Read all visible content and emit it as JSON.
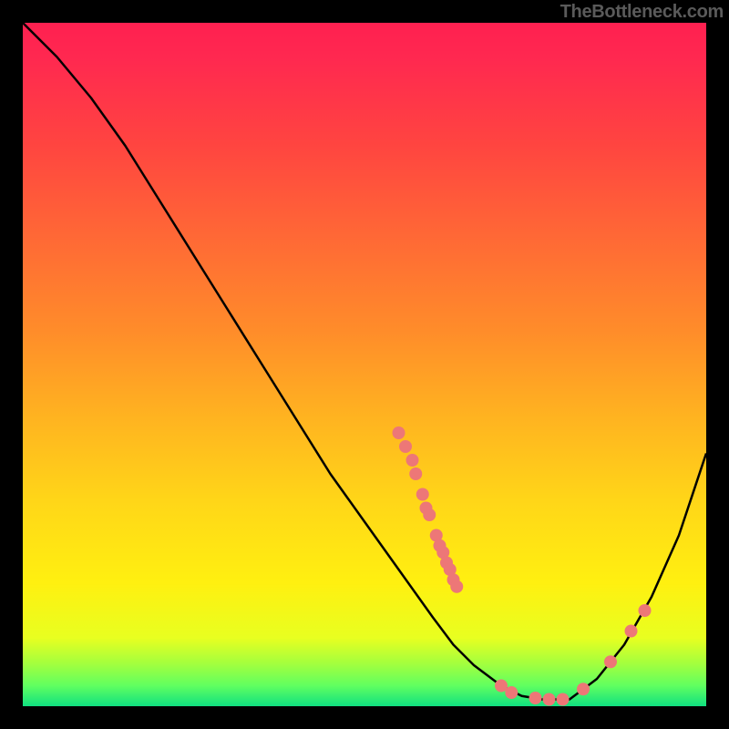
{
  "attribution": "TheBottleneck.com",
  "chart_data": {
    "type": "line",
    "title": "",
    "xlabel": "",
    "ylabel": "",
    "xlim": [
      0,
      100
    ],
    "ylim": [
      0,
      100
    ],
    "series": [
      {
        "name": "bottleneck-curve",
        "x": [
          0,
          5,
          10,
          15,
          20,
          25,
          30,
          35,
          40,
          45,
          50,
          55,
          60,
          63,
          66,
          70,
          73,
          76,
          80,
          84,
          88,
          92,
          96,
          100
        ],
        "y": [
          100,
          95,
          89,
          82,
          74,
          66,
          58,
          50,
          42,
          34,
          27,
          20,
          13,
          9,
          6,
          3,
          1.5,
          1,
          1,
          4,
          9,
          16,
          25,
          37
        ],
        "color": "#000000",
        "stroke_width": 2.5
      }
    ],
    "markers": {
      "name": "scatter-dots",
      "color": "#ed7777",
      "radius": 7,
      "points": [
        {
          "x": 55,
          "y": 40
        },
        {
          "x": 56,
          "y": 38
        },
        {
          "x": 57,
          "y": 36
        },
        {
          "x": 57.5,
          "y": 34
        },
        {
          "x": 58.5,
          "y": 31
        },
        {
          "x": 59,
          "y": 29
        },
        {
          "x": 59.5,
          "y": 28
        },
        {
          "x": 60.5,
          "y": 25
        },
        {
          "x": 61,
          "y": 23.5
        },
        {
          "x": 61.5,
          "y": 22.5
        },
        {
          "x": 62,
          "y": 21
        },
        {
          "x": 62.5,
          "y": 20
        },
        {
          "x": 63,
          "y": 18.5
        },
        {
          "x": 63.5,
          "y": 17.5
        },
        {
          "x": 70,
          "y": 3
        },
        {
          "x": 71.5,
          "y": 2
        },
        {
          "x": 75,
          "y": 1.2
        },
        {
          "x": 77,
          "y": 1
        },
        {
          "x": 79,
          "y": 1
        },
        {
          "x": 82,
          "y": 2.5
        },
        {
          "x": 86,
          "y": 6.5
        },
        {
          "x": 89,
          "y": 11
        },
        {
          "x": 91,
          "y": 14
        }
      ]
    }
  }
}
